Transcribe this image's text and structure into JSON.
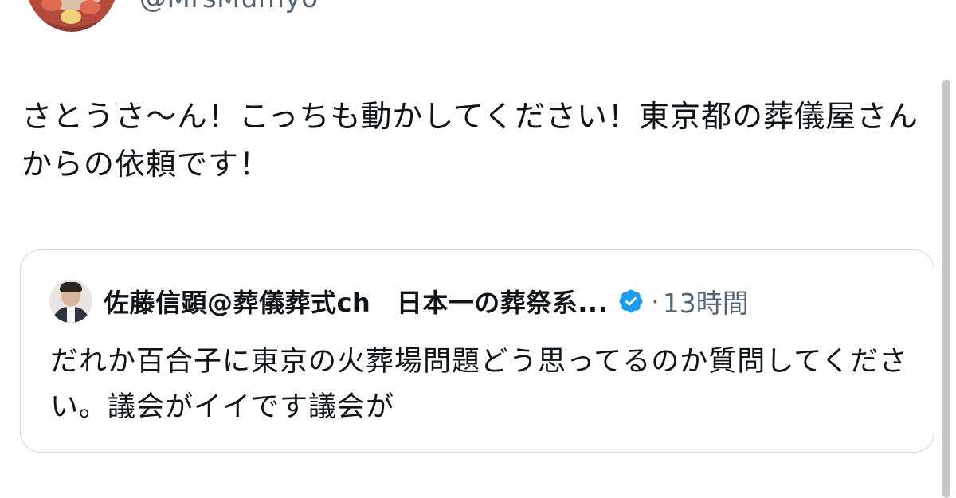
{
  "author": {
    "handle": "@MrsMumyo",
    "avatar_icon": "avatar-flower-icon"
  },
  "tweet": {
    "text": "さとうさ〜ん！こっちも動かしてください！東京都の葬儀屋さんからの依頼です！"
  },
  "quoted_tweet": {
    "name": "佐藤信顕@葬儀葬式ch　日本一の葬祭系...",
    "verified": true,
    "verified_color": "#1d9bf0",
    "separator": "·",
    "time": "13時間",
    "text": "だれか百合子に東京の火葬場問題どう思ってるのか質問してください。議会がイイです議会が"
  }
}
